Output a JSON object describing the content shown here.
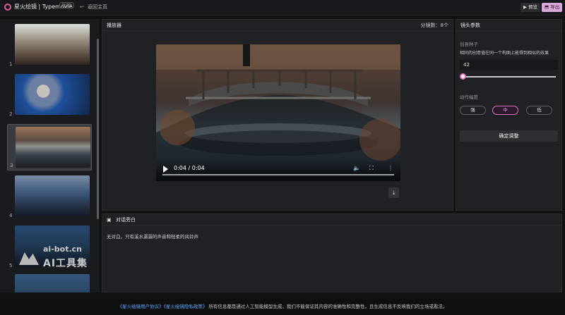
{
  "app": {
    "title": "星火绘镜 | Typemovie",
    "beta_badge": "测试版",
    "back_label": "返回主页",
    "preview_label": "预览",
    "export_label": "导出"
  },
  "sidebar": {
    "items": [
      {
        "index": "1",
        "active": false
      },
      {
        "index": "2",
        "active": false
      },
      {
        "index": "3",
        "active": true
      },
      {
        "index": "4",
        "active": false
      },
      {
        "index": "5",
        "active": false
      },
      {
        "index": "6",
        "active": false
      }
    ]
  },
  "player": {
    "title": "播放器",
    "shot_count": "分镜数：8个",
    "current_time": "0:04 / 0:04",
    "play_icon": "play-icon",
    "volume_icon": "volume-icon",
    "fullscreen_icon": "fullscreen-icon",
    "more_icon": "more-icon",
    "download_icon": "download-icon"
  },
  "params": {
    "title": "镜头参数",
    "seed_label": "创意种子",
    "seed_desc": "相同的创意值在同一个构图上能得到相似的效果",
    "seed_value": "42",
    "motion_label": "动作幅度",
    "motion_options": [
      "强",
      "中",
      "低"
    ],
    "selected_motion": "中",
    "confirm_label": "确定调整"
  },
  "dialog": {
    "title": "对话旁白",
    "text": "无对白，只有溪水潺潺的声音和轻柔的风铃声"
  },
  "watermark": {
    "line1": "ai-bot.cn",
    "line2": "AI工具集"
  },
  "footer": {
    "links": "《星火绘镜用户协议》《星火绘镜隐私政策》",
    "text": "所有信息都是通过人工智能模型生成，我们不能保证其内容的准确性和完整性，且生成信息不反映我们的立场或看法。"
  },
  "colors": {
    "accent": "#e46fcb",
    "link": "#5ea7ff",
    "background": "#111214",
    "panel": "#202125"
  }
}
